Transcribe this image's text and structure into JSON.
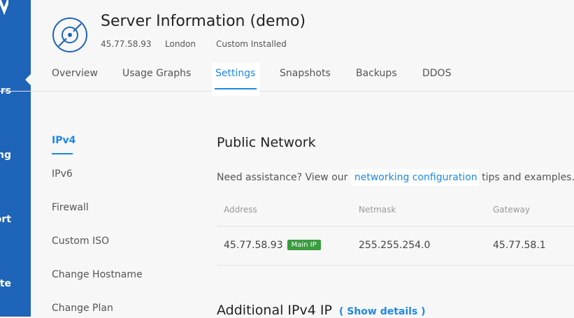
{
  "sidebar": {
    "items": [
      {
        "label": "ers"
      },
      {
        "label": "ng"
      },
      {
        "label": "ort"
      },
      {
        "label": "ate"
      }
    ]
  },
  "header": {
    "title": "Server Information (demo)",
    "ip": "45.77.58.93",
    "location": "London",
    "os": "Custom Installed"
  },
  "tabs": [
    "Overview",
    "Usage Graphs",
    "Settings",
    "Snapshots",
    "Backups",
    "DDOS"
  ],
  "subnav": [
    "IPv4",
    "IPv6",
    "Firewall",
    "Custom ISO",
    "Change Hostname",
    "Change Plan"
  ],
  "public_network": {
    "title": "Public Network",
    "help_prefix": "Need assistance? View our",
    "help_link": "networking configuration",
    "help_suffix": "tips and examples.",
    "headers": [
      "Address",
      "Netmask",
      "Gateway"
    ],
    "row": {
      "address": "45.77.58.93",
      "badge": "Main IP",
      "netmask": "255.255.254.0",
      "gateway": "45.77.58.1"
    }
  },
  "additional": {
    "title": "Additional IPv4 IP",
    "show_details": "( Show details )"
  },
  "colors": {
    "sidebar": "#1e64b8",
    "accent": "#1e88e5",
    "badge": "#3a9b3f"
  }
}
